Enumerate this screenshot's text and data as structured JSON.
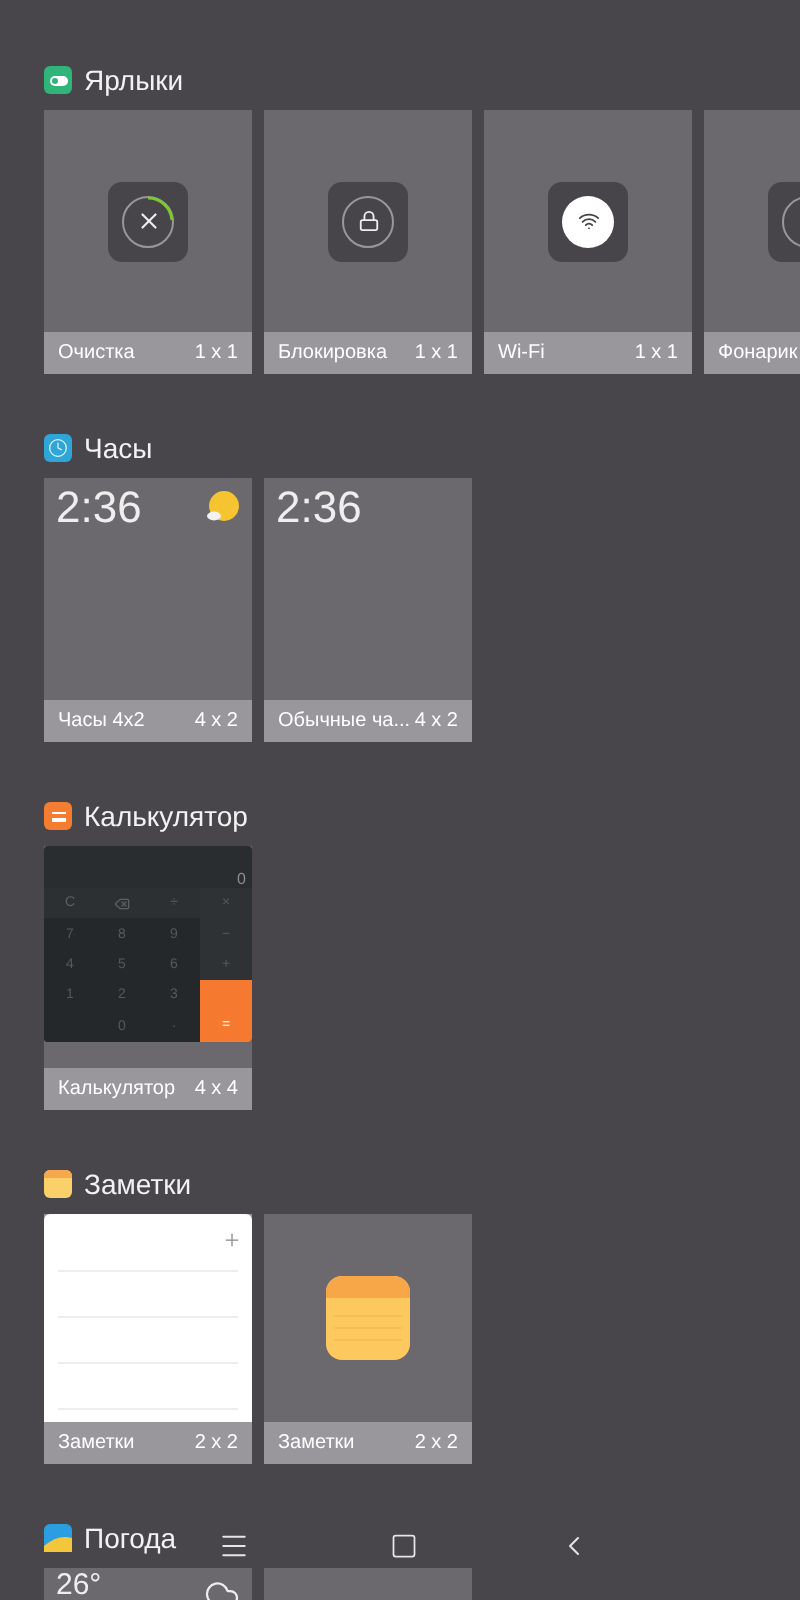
{
  "sections": [
    {
      "title": "Ярлыки",
      "widgets": [
        {
          "kind": "shortcut",
          "on": false,
          "name": "Очистка",
          "size": "1 x 1"
        },
        {
          "kind": "shortcut",
          "on": false,
          "name": "Блокировка",
          "size": "1 x 1"
        },
        {
          "kind": "shortcut",
          "on": true,
          "name": "Wi-Fi",
          "size": "1 x 1"
        },
        {
          "kind": "shortcut",
          "on": false,
          "name": "Фонарик"
        }
      ]
    },
    {
      "title": "Часы",
      "widgets": [
        {
          "kind": "clock_weather",
          "time": "2:36",
          "name": "Часы 4x2",
          "size": "4 x 2"
        },
        {
          "kind": "clock",
          "time": "2:36",
          "name": "Обычные ча...",
          "size": "4 x 2"
        }
      ]
    },
    {
      "title": "Калькулятор",
      "widgets": [
        {
          "kind": "calculator",
          "display": "0",
          "name": "Калькулятор",
          "size": "4 x 4",
          "keys": [
            {
              "kind": "top",
              "label": "C"
            },
            {
              "kind": "backspace"
            },
            {
              "kind": "top",
              "label": "÷"
            },
            {
              "kind": "op",
              "label": "×"
            },
            {
              "kind": "digit",
              "label": "7"
            },
            {
              "kind": "digit",
              "label": "8"
            },
            {
              "kind": "digit",
              "label": "9"
            },
            {
              "kind": "op",
              "label": "−"
            },
            {
              "kind": "digit",
              "label": "4"
            },
            {
              "kind": "digit",
              "label": "5"
            },
            {
              "kind": "digit",
              "label": "6"
            },
            {
              "kind": "op",
              "label": "+"
            },
            {
              "kind": "digit",
              "label": "1"
            },
            {
              "kind": "digit",
              "label": "2"
            },
            {
              "kind": "digit",
              "label": "3"
            },
            {
              "kind": "blank"
            },
            {
              "kind": "digit",
              "label": "0"
            },
            {
              "kind": "digit",
              "label": "·"
            },
            {
              "kind": "equals",
              "label": "="
            }
          ]
        }
      ]
    },
    {
      "title": "Заметки",
      "widgets": [
        {
          "kind": "notes_list",
          "name": "Заметки",
          "size": "2 x 2"
        },
        {
          "kind": "notes_icon",
          "name": "Заметки",
          "size": "2 x 2"
        }
      ]
    },
    {
      "title": "Погода",
      "widgets": [
        {
          "kind": "weather",
          "temp": "26°"
        },
        {
          "kind": "weather_add"
        }
      ]
    }
  ]
}
